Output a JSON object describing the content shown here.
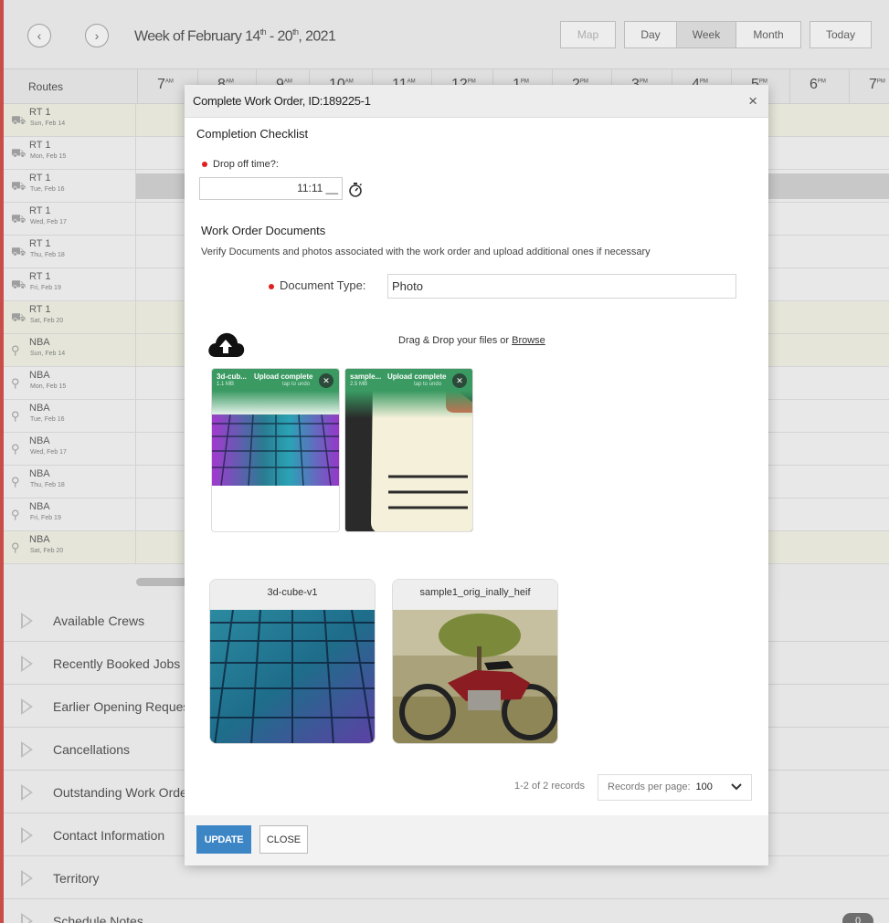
{
  "toolbar": {
    "week_prefix": "Week of February 14",
    "week_sup1": "th",
    "week_mid": " - 20",
    "week_sup2": "th",
    "week_suffix": ", 2021",
    "map": "Map",
    "day": "Day",
    "week": "Week",
    "month": "Month",
    "today": "Today"
  },
  "schedule": {
    "routes_header": "Routes",
    "hours": [
      {
        "num": "7",
        "sup": "AM"
      },
      {
        "num": "8",
        "sup": "AM"
      },
      {
        "num": "9",
        "sup": "AM"
      },
      {
        "num": "10",
        "sup": "AM"
      },
      {
        "num": "11",
        "sup": "AM"
      },
      {
        "num": "12",
        "sup": "PM"
      },
      {
        "num": "1",
        "sup": "PM"
      },
      {
        "num": "2",
        "sup": "PM"
      },
      {
        "num": "3",
        "sup": "PM"
      },
      {
        "num": "4",
        "sup": "PM"
      },
      {
        "num": "5",
        "sup": "PM"
      },
      {
        "num": "6",
        "sup": "PM"
      },
      {
        "num": "7",
        "sup": "PM"
      }
    ],
    "rows": [
      {
        "name": "RT 1",
        "date": "Sun, Feb 14"
      },
      {
        "name": "RT 1",
        "date": "Mon, Feb 15"
      },
      {
        "name": "RT 1",
        "date": "Tue, Feb 16"
      },
      {
        "name": "RT 1",
        "date": "Wed, Feb 17"
      },
      {
        "name": "RT 1",
        "date": "Thu, Feb 18"
      },
      {
        "name": "RT 1",
        "date": "Fri, Feb 19"
      },
      {
        "name": "RT 1",
        "date": "Sat, Feb 20"
      },
      {
        "name": "NBA",
        "date": "Sun, Feb 14"
      },
      {
        "name": "NBA",
        "date": "Mon, Feb 15"
      },
      {
        "name": "NBA",
        "date": "Tue, Feb 16"
      },
      {
        "name": "NBA",
        "date": "Wed, Feb 17"
      },
      {
        "name": "NBA",
        "date": "Thu, Feb 18"
      },
      {
        "name": "NBA",
        "date": "Fri, Feb 19"
      },
      {
        "name": "NBA",
        "date": "Sat, Feb 20"
      }
    ]
  },
  "panels": [
    "Available Crews",
    "Recently Booked Jobs",
    "Earlier Opening Reques",
    "Cancellations",
    "Outstanding Work Orde",
    "Contact Information",
    "Territory",
    "Schedule Notes"
  ],
  "panel_badge": "0",
  "modal": {
    "title": "Complete Work Order, ID:189225-1",
    "close_glyph": "×",
    "checklist_title": "Completion Checklist",
    "dropoff_label": "Drop off time?:",
    "dropoff_value": "11:11 __",
    "documents_title": "Work Order Documents",
    "documents_desc": "Verify Documents and photos associated with the work order and upload additional ones if necessary",
    "doc_type_label": "Document Type:",
    "doc_type_value": "Photo",
    "drag_text": "Drag & Drop your files or ",
    "browse": "Browse",
    "uploads": [
      {
        "name": "3d-cub...",
        "size": "1.1 MB",
        "status": "Upload complete",
        "undo": "tap to undo"
      },
      {
        "name": "sample...",
        "size": "2.5 MB",
        "status": "Upload complete",
        "undo": "tap to undo"
      }
    ],
    "thumbs": [
      {
        "title": "3d-cube-v1"
      },
      {
        "title": "sample1_orig_inally_heif"
      }
    ],
    "records": "1-2 of 2 records",
    "records_per_page_label": "Records per page:",
    "records_per_page_value": "100",
    "update": "UPDATE",
    "close": "CLOSE"
  },
  "colors": {
    "accent_red": "#d9534f",
    "update_blue": "#3d86c6",
    "upload_green": "#3a9a62",
    "row_highlight": "#f7f8ea",
    "required_dot": "#e02020"
  }
}
